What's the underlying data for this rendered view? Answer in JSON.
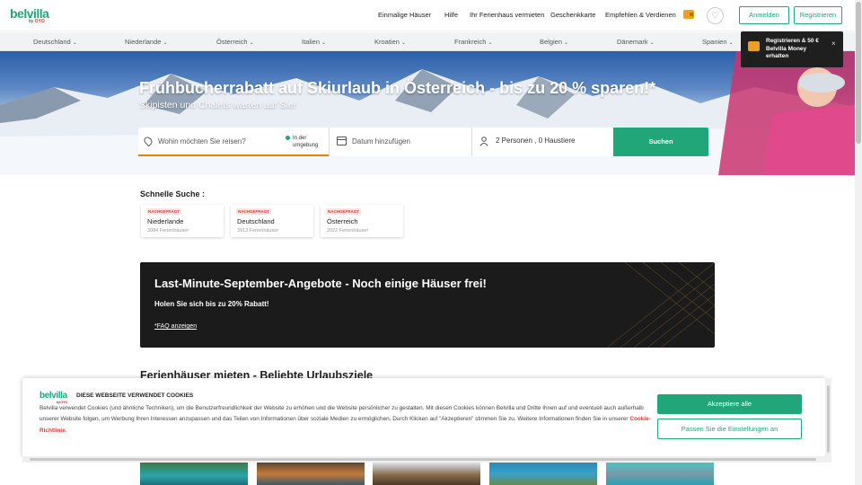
{
  "header": {
    "brand": "belvilla",
    "brand_by": "by",
    "brand_oyo": "OYO",
    "nav": [
      "Einmalige Häuser",
      "Hilfe",
      "Ihr Ferienhaus vermieten",
      "Geschenkkarte",
      "Empfehlen & Verdienen"
    ],
    "login": "Anmelden",
    "register": "Registrieren",
    "wallet_icon": "wallet-icon",
    "heart_icon": "heart-icon"
  },
  "countries": [
    "Deutschland",
    "Niederlande",
    "Österreich",
    "Italien",
    "Kroatien",
    "Frankreich",
    "Belgien",
    "Dänemark",
    "Spanien"
  ],
  "promo_popup": {
    "text": "Registrieren & 50 € Belvilla Money erhalten",
    "close": "×"
  },
  "hero": {
    "title": "Frühbucherrabatt auf Skiurlaub in Österreich - bis zu 20 % sparen!*",
    "subtitle": "Skipisten und Chalets warten auf Sie!"
  },
  "search": {
    "where_placeholder": "Wohin möchten Sie reisen?",
    "nearby_line1": "In der",
    "nearby_line2": "umgebung",
    "date_placeholder": "Datum hinzufügen",
    "guests": "2 Personen , 0 Haustiere",
    "button": "Suchen"
  },
  "quick_search": {
    "title": "Schnelle Suche :",
    "items": [
      {
        "badge": "NACHGEFRAGT",
        "name": "Niederlande",
        "count": "3084 Ferienhäuser"
      },
      {
        "badge": "NACHGEFRAGT",
        "name": "Deutschland",
        "count": "3913 Ferienhäuser"
      },
      {
        "badge": "NACHGEFRAGT",
        "name": "Österreich",
        "count": "2022 Ferienhäuser"
      }
    ]
  },
  "last_minute": {
    "title": "Last-Minute-September-Angebote - Noch einige Häuser frei!",
    "subtitle": "Holen Sie sich bis zu 20% Rabatt!",
    "faq": "*FAQ anzeigen"
  },
  "popular": {
    "title": "Ferienhäuser mieten - Beliebte Urlaubsziele"
  },
  "cookie": {
    "brand": "belvilla",
    "brand_by": "by",
    "brand_oyo": "OYO",
    "title": "DIESE WEBSEITE VERWENDET COOKIES",
    "text": "Belvilla verwendet Cookies (und ähnliche Techniken), um die Benutzerfreundlichkeit der Website zu erhöhen und die Website persönlicher zu gestalten. Mit diesen Cookies können Belvilla und Dritte Ihnen auf und eventuell auch außerhalb unserer Website folgen, um Werbung Ihren Interessen anzupassen und das Teilen von Informationen über soziale Medien zu ermöglichen. Durch Klicken auf \"Akzeptieren\" stimmen Sie zu. Weitere Informationen finden Sie in unserer",
    "link": "Cookie-Richtlinie",
    "period": ".",
    "accept": "Akzeptiere alle",
    "settings": "Passen Sie die Einstellungen an"
  },
  "colors": {
    "brand_green": "#21a67a",
    "search_underline": "#f07c00",
    "badge_red": "#d2403a",
    "dark_banner": "#1b1b1b"
  }
}
